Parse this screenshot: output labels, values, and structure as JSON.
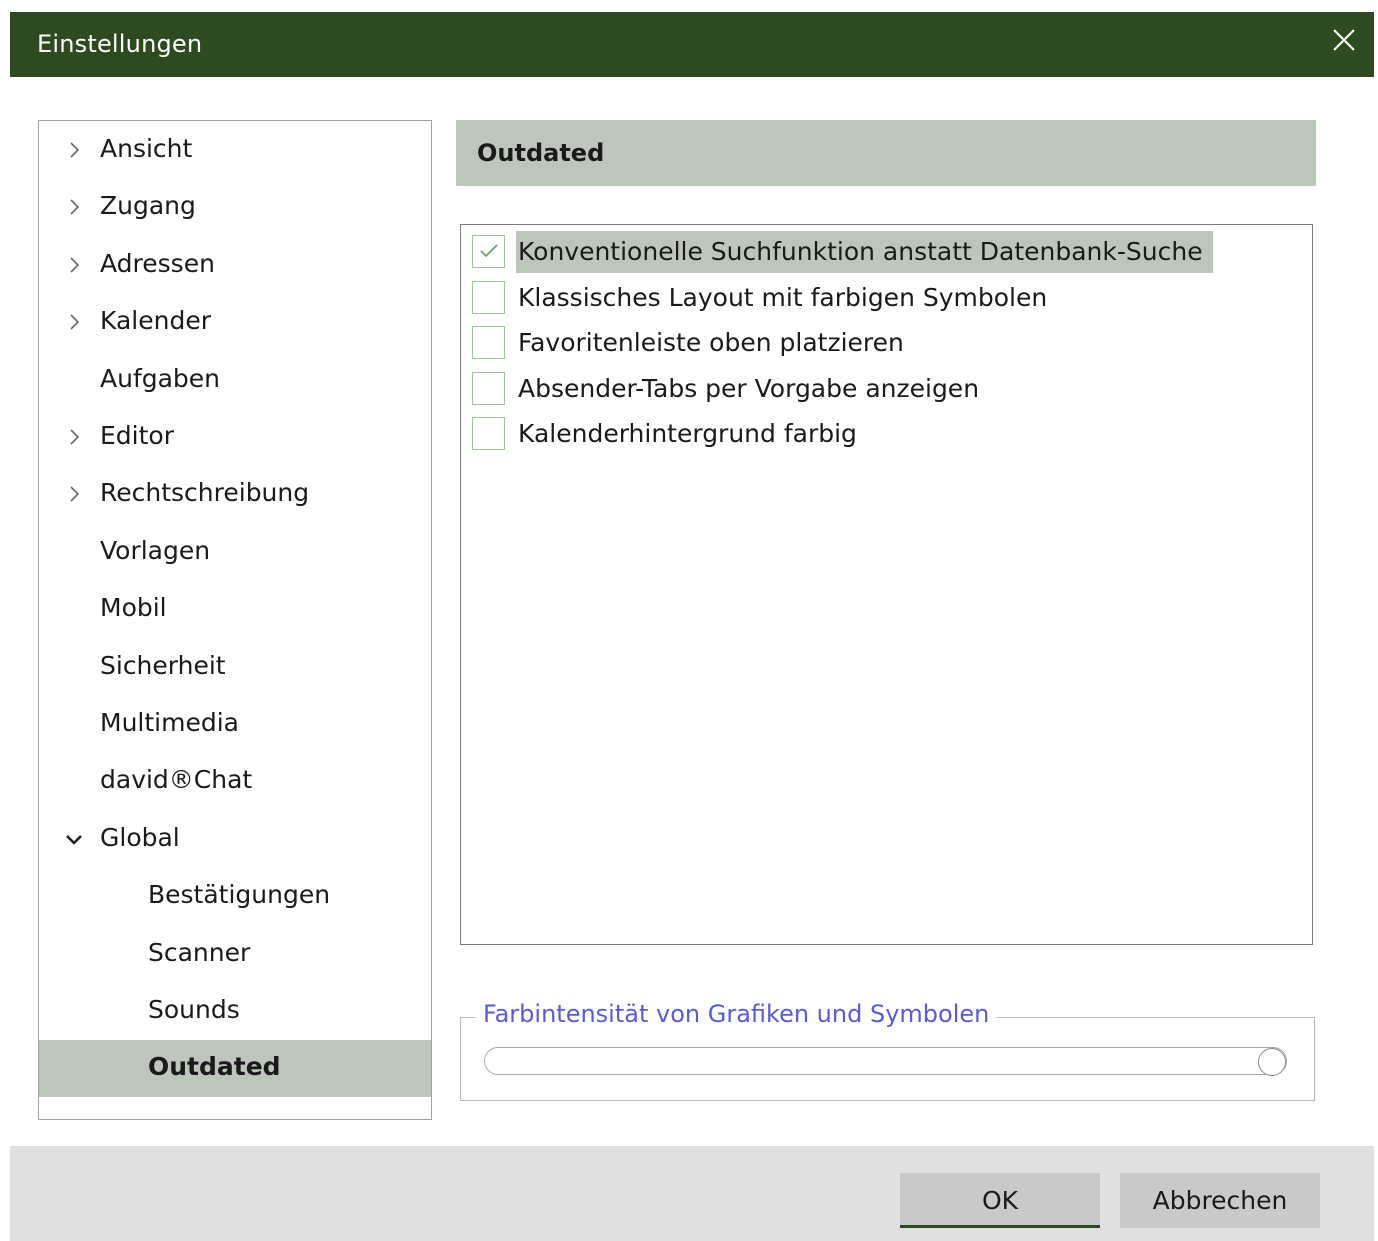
{
  "window": {
    "title": "Einstellungen",
    "close_icon": "close-icon"
  },
  "sidebar": {
    "items": [
      {
        "label": "Ansicht",
        "expander": "chevron-right-icon"
      },
      {
        "label": "Zugang",
        "expander": "chevron-right-icon"
      },
      {
        "label": "Adressen",
        "expander": "chevron-right-icon"
      },
      {
        "label": "Kalender",
        "expander": "chevron-right-icon"
      },
      {
        "label": "Aufgaben",
        "expander": null
      },
      {
        "label": "Editor",
        "expander": "chevron-right-icon"
      },
      {
        "label": "Rechtschreibung",
        "expander": "chevron-right-icon"
      },
      {
        "label": "Vorlagen",
        "expander": null
      },
      {
        "label": "Mobil",
        "expander": null
      },
      {
        "label": "Sicherheit",
        "expander": null
      },
      {
        "label": "Multimedia",
        "expander": null
      },
      {
        "label": "david®Chat",
        "expander": null
      },
      {
        "label": "Global",
        "expander": "chevron-down-icon",
        "expanded": true
      },
      {
        "label": "Bestätigungen",
        "expander": null,
        "child": true
      },
      {
        "label": "Scanner",
        "expander": null,
        "child": true
      },
      {
        "label": "Sounds",
        "expander": null,
        "child": true
      },
      {
        "label": "Outdated",
        "expander": null,
        "child": true,
        "selected": true
      }
    ]
  },
  "section": {
    "title": "Outdated"
  },
  "options": [
    {
      "label": "Konventionelle Suchfunktion anstatt Datenbank-Suche",
      "checked": true,
      "highlighted": true
    },
    {
      "label": "Klassisches Layout mit farbigen Symbolen",
      "checked": false
    },
    {
      "label": "Favoritenleiste oben platzieren",
      "checked": false
    },
    {
      "label": "Absender-Tabs per Vorgabe anzeigen",
      "checked": false
    },
    {
      "label": "Kalenderhintergrund farbig",
      "checked": false
    }
  ],
  "color_intensity": {
    "legend": "Farbintensität von Grafiken und Symbolen",
    "value": 1.0
  },
  "footer": {
    "ok_label": "OK",
    "cancel_label": "Abbrechen"
  },
  "colors": {
    "titlebar": "#2d4a20",
    "selection": "#bcc6bb",
    "legend_text": "#5a5ad2",
    "checkbox_border": "#9fc19b",
    "check_mark": "#5aa34f"
  }
}
